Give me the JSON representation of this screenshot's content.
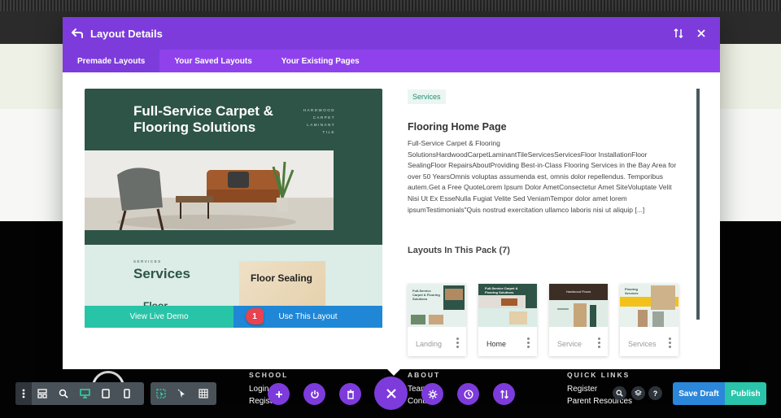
{
  "modal": {
    "title": "Layout Details",
    "tabs": [
      {
        "label": "Premade Layouts",
        "active": true
      },
      {
        "label": "Your Saved Layouts",
        "active": false
      },
      {
        "label": "Your Existing Pages",
        "active": false
      }
    ]
  },
  "preview": {
    "hero_title": "Full-Service Carpet & Flooring Solutions",
    "hero_list": [
      "HARDWOOD",
      "CARPET",
      "LAMINANT",
      "TILE"
    ],
    "section_small": "SERVICES",
    "section_title": "Services",
    "card_title": "Floor Sealing",
    "partial_text": "Floor",
    "view_demo_label": "View Live Demo",
    "use_layout_label": "Use This Layout",
    "step_badge": "1"
  },
  "details": {
    "category_tag": "Services",
    "layout_name": "Flooring Home Page",
    "description": "Full-Service Carpet & Flooring SolutionsHardwoodCarpetLaminantTileServicesServicesFloor InstallationFloor SealingFloor RepairsAboutProviding Best-in-Class Flooring Services in the Bay Area for over 50 YearsOmnis voluptas assumenda est, omnis dolor repellendus. Temporibus autem.Get a Free QuoteLorem Ipsum Dolor AmetConsectetur Amet SiteVoluptate Velit Nisi Ut Ex EsseNulla Fugiat Velite Sed VeniamTempor dolor amet lorem ipsumTestimonials\"Quis nostrud exercitation ullamco laboris nisi ut aliquip [...]",
    "pack_title": "Layouts In This Pack (7)",
    "pack_layouts": [
      {
        "label": "Landing",
        "selected": false
      },
      {
        "label": "Home",
        "selected": true
      },
      {
        "label": "Service",
        "selected": false
      },
      {
        "label": "Services",
        "selected": false
      }
    ],
    "thumb_texts": {
      "landing_title": "Full-Service Carpet & Flooring Solutions",
      "home_title": "Full-Service Carpet & Flooring Solutions",
      "service_title": "Hardwood Floors",
      "services_title": "Flooring Services"
    }
  },
  "footer": {
    "columns": [
      {
        "heading": "SCHOOL",
        "links": [
          "Login",
          "Register"
        ]
      },
      {
        "heading": "ABOUT",
        "links": [
          "Team",
          "Contact"
        ]
      },
      {
        "heading": "QUICK LINKS",
        "links": [
          "Register",
          "Parent Resources"
        ]
      }
    ]
  },
  "toolbar": {
    "help_label": "?",
    "save_draft_label": "Save Draft",
    "publish_label": "Publish"
  },
  "colors": {
    "purple": "#7d3bdc",
    "purple_light": "#8f42ec",
    "teal": "#28c4a7",
    "blue": "#1f87d6",
    "badge_red": "#e8434f",
    "preview_green": "#2e5447"
  }
}
